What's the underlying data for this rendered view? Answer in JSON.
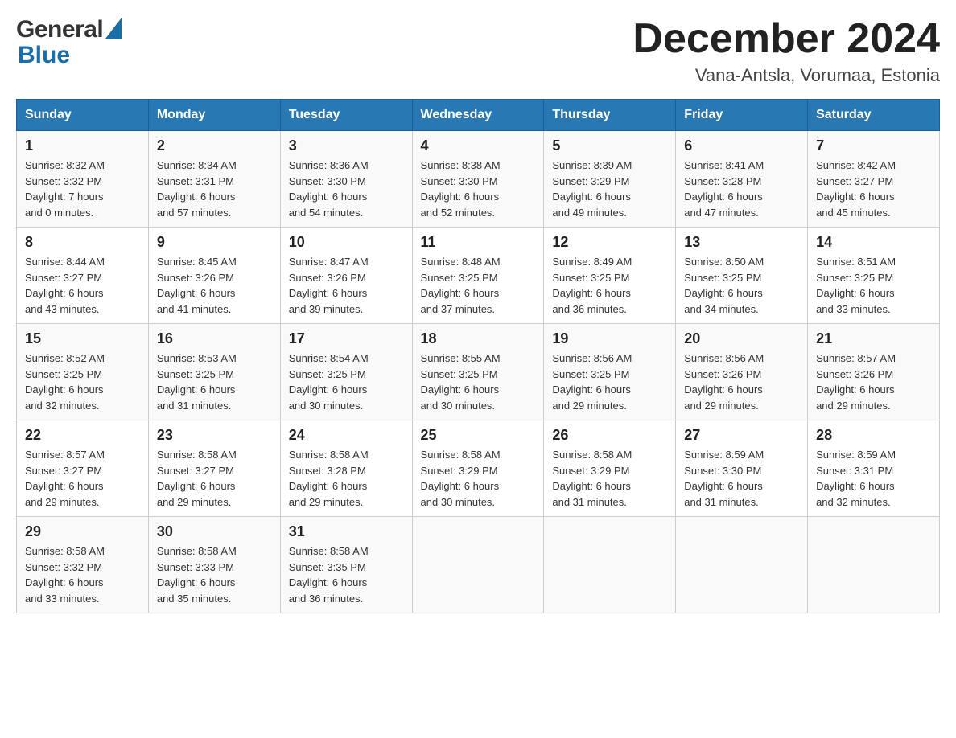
{
  "header": {
    "month_title": "December 2024",
    "subtitle": "Vana-Antsla, Vorumaa, Estonia",
    "logo_general": "General",
    "logo_blue": "Blue"
  },
  "weekdays": [
    "Sunday",
    "Monday",
    "Tuesday",
    "Wednesday",
    "Thursday",
    "Friday",
    "Saturday"
  ],
  "weeks": [
    [
      {
        "day": "1",
        "lines": [
          "Sunrise: 8:32 AM",
          "Sunset: 3:32 PM",
          "Daylight: 7 hours",
          "and 0 minutes."
        ]
      },
      {
        "day": "2",
        "lines": [
          "Sunrise: 8:34 AM",
          "Sunset: 3:31 PM",
          "Daylight: 6 hours",
          "and 57 minutes."
        ]
      },
      {
        "day": "3",
        "lines": [
          "Sunrise: 8:36 AM",
          "Sunset: 3:30 PM",
          "Daylight: 6 hours",
          "and 54 minutes."
        ]
      },
      {
        "day": "4",
        "lines": [
          "Sunrise: 8:38 AM",
          "Sunset: 3:30 PM",
          "Daylight: 6 hours",
          "and 52 minutes."
        ]
      },
      {
        "day": "5",
        "lines": [
          "Sunrise: 8:39 AM",
          "Sunset: 3:29 PM",
          "Daylight: 6 hours",
          "and 49 minutes."
        ]
      },
      {
        "day": "6",
        "lines": [
          "Sunrise: 8:41 AM",
          "Sunset: 3:28 PM",
          "Daylight: 6 hours",
          "and 47 minutes."
        ]
      },
      {
        "day": "7",
        "lines": [
          "Sunrise: 8:42 AM",
          "Sunset: 3:27 PM",
          "Daylight: 6 hours",
          "and 45 minutes."
        ]
      }
    ],
    [
      {
        "day": "8",
        "lines": [
          "Sunrise: 8:44 AM",
          "Sunset: 3:27 PM",
          "Daylight: 6 hours",
          "and 43 minutes."
        ]
      },
      {
        "day": "9",
        "lines": [
          "Sunrise: 8:45 AM",
          "Sunset: 3:26 PM",
          "Daylight: 6 hours",
          "and 41 minutes."
        ]
      },
      {
        "day": "10",
        "lines": [
          "Sunrise: 8:47 AM",
          "Sunset: 3:26 PM",
          "Daylight: 6 hours",
          "and 39 minutes."
        ]
      },
      {
        "day": "11",
        "lines": [
          "Sunrise: 8:48 AM",
          "Sunset: 3:25 PM",
          "Daylight: 6 hours",
          "and 37 minutes."
        ]
      },
      {
        "day": "12",
        "lines": [
          "Sunrise: 8:49 AM",
          "Sunset: 3:25 PM",
          "Daylight: 6 hours",
          "and 36 minutes."
        ]
      },
      {
        "day": "13",
        "lines": [
          "Sunrise: 8:50 AM",
          "Sunset: 3:25 PM",
          "Daylight: 6 hours",
          "and 34 minutes."
        ]
      },
      {
        "day": "14",
        "lines": [
          "Sunrise: 8:51 AM",
          "Sunset: 3:25 PM",
          "Daylight: 6 hours",
          "and 33 minutes."
        ]
      }
    ],
    [
      {
        "day": "15",
        "lines": [
          "Sunrise: 8:52 AM",
          "Sunset: 3:25 PM",
          "Daylight: 6 hours",
          "and 32 minutes."
        ]
      },
      {
        "day": "16",
        "lines": [
          "Sunrise: 8:53 AM",
          "Sunset: 3:25 PM",
          "Daylight: 6 hours",
          "and 31 minutes."
        ]
      },
      {
        "day": "17",
        "lines": [
          "Sunrise: 8:54 AM",
          "Sunset: 3:25 PM",
          "Daylight: 6 hours",
          "and 30 minutes."
        ]
      },
      {
        "day": "18",
        "lines": [
          "Sunrise: 8:55 AM",
          "Sunset: 3:25 PM",
          "Daylight: 6 hours",
          "and 30 minutes."
        ]
      },
      {
        "day": "19",
        "lines": [
          "Sunrise: 8:56 AM",
          "Sunset: 3:25 PM",
          "Daylight: 6 hours",
          "and 29 minutes."
        ]
      },
      {
        "day": "20",
        "lines": [
          "Sunrise: 8:56 AM",
          "Sunset: 3:26 PM",
          "Daylight: 6 hours",
          "and 29 minutes."
        ]
      },
      {
        "day": "21",
        "lines": [
          "Sunrise: 8:57 AM",
          "Sunset: 3:26 PM",
          "Daylight: 6 hours",
          "and 29 minutes."
        ]
      }
    ],
    [
      {
        "day": "22",
        "lines": [
          "Sunrise: 8:57 AM",
          "Sunset: 3:27 PM",
          "Daylight: 6 hours",
          "and 29 minutes."
        ]
      },
      {
        "day": "23",
        "lines": [
          "Sunrise: 8:58 AM",
          "Sunset: 3:27 PM",
          "Daylight: 6 hours",
          "and 29 minutes."
        ]
      },
      {
        "day": "24",
        "lines": [
          "Sunrise: 8:58 AM",
          "Sunset: 3:28 PM",
          "Daylight: 6 hours",
          "and 29 minutes."
        ]
      },
      {
        "day": "25",
        "lines": [
          "Sunrise: 8:58 AM",
          "Sunset: 3:29 PM",
          "Daylight: 6 hours",
          "and 30 minutes."
        ]
      },
      {
        "day": "26",
        "lines": [
          "Sunrise: 8:58 AM",
          "Sunset: 3:29 PM",
          "Daylight: 6 hours",
          "and 31 minutes."
        ]
      },
      {
        "day": "27",
        "lines": [
          "Sunrise: 8:59 AM",
          "Sunset: 3:30 PM",
          "Daylight: 6 hours",
          "and 31 minutes."
        ]
      },
      {
        "day": "28",
        "lines": [
          "Sunrise: 8:59 AM",
          "Sunset: 3:31 PM",
          "Daylight: 6 hours",
          "and 32 minutes."
        ]
      }
    ],
    [
      {
        "day": "29",
        "lines": [
          "Sunrise: 8:58 AM",
          "Sunset: 3:32 PM",
          "Daylight: 6 hours",
          "and 33 minutes."
        ]
      },
      {
        "day": "30",
        "lines": [
          "Sunrise: 8:58 AM",
          "Sunset: 3:33 PM",
          "Daylight: 6 hours",
          "and 35 minutes."
        ]
      },
      {
        "day": "31",
        "lines": [
          "Sunrise: 8:58 AM",
          "Sunset: 3:35 PM",
          "Daylight: 6 hours",
          "and 36 minutes."
        ]
      },
      {
        "day": "",
        "lines": []
      },
      {
        "day": "",
        "lines": []
      },
      {
        "day": "",
        "lines": []
      },
      {
        "day": "",
        "lines": []
      }
    ]
  ]
}
